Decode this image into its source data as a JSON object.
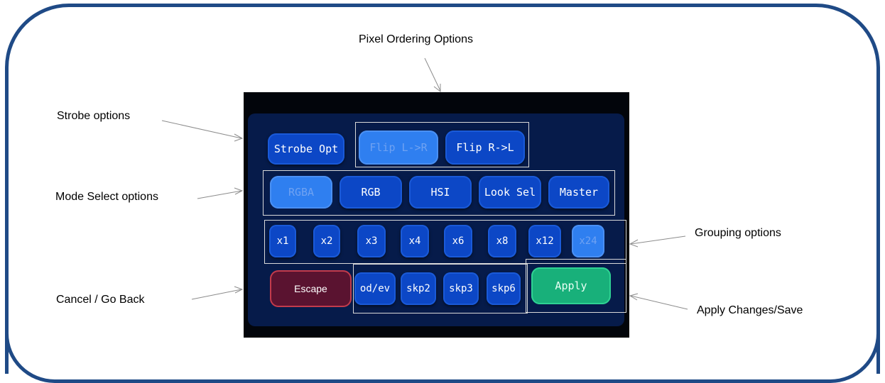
{
  "callouts": {
    "pixel_ordering": "Pixel Ordering Options",
    "strobe": "Strobe options",
    "mode_select": "Mode Select options",
    "grouping": "Grouping options",
    "cancel": "Cancel / Go Back",
    "apply": "Apply Changes/Save"
  },
  "device": {
    "strobe_opt": "Strobe Opt",
    "flip_lr": "Flip L->R",
    "flip_rl": "Flip R->L",
    "modes": [
      "RGBA",
      "RGB",
      "HSI",
      "Look Sel",
      "Master"
    ],
    "active_mode": "RGBA",
    "grouping": [
      "x1",
      "x2",
      "x3",
      "x4",
      "x6",
      "x8",
      "x12",
      "x24"
    ],
    "active_grouping": "x24",
    "skip": [
      "od/ev",
      "skp2",
      "skp3",
      "skp6"
    ],
    "escape": "Escape",
    "apply": "Apply"
  },
  "colors": {
    "frame": "#1f4a86",
    "button": "#0c47c6",
    "active_button": "#2f7ff0",
    "escape": "#5a1330",
    "apply": "#18b07a"
  }
}
